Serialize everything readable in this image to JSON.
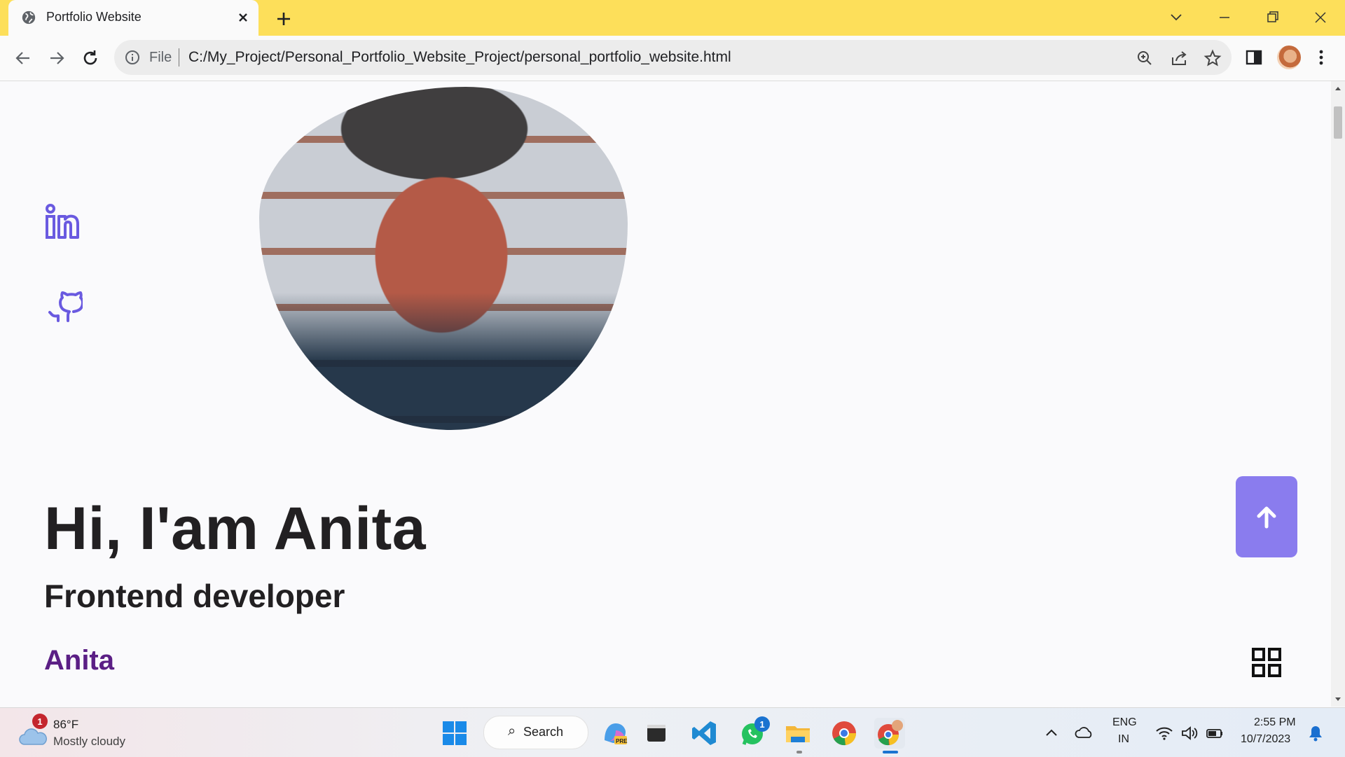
{
  "browser": {
    "tab_title": "Portfolio Website",
    "omnibox_scheme": "File",
    "url": "C:/My_Project/Personal_Portfolio_Website_Project/personal_portfolio_website.html"
  },
  "page": {
    "social_icons": [
      "linkedin-icon",
      "github-icon"
    ],
    "hero_title": "Hi, I'am Anita",
    "hero_subtitle": "Frontend developer",
    "brand_name": "Anita",
    "accent_color": "#8a7cee",
    "brand_color": "#5b1f85"
  },
  "taskbar": {
    "weather_temp": "86°F",
    "weather_desc": "Mostly cloudy",
    "weather_badge": "1",
    "search_label": "Search",
    "whatsapp_badge": "1",
    "lang_line1": "ENG",
    "lang_line2": "IN",
    "time": "2:55 PM",
    "date": "10/7/2023"
  }
}
